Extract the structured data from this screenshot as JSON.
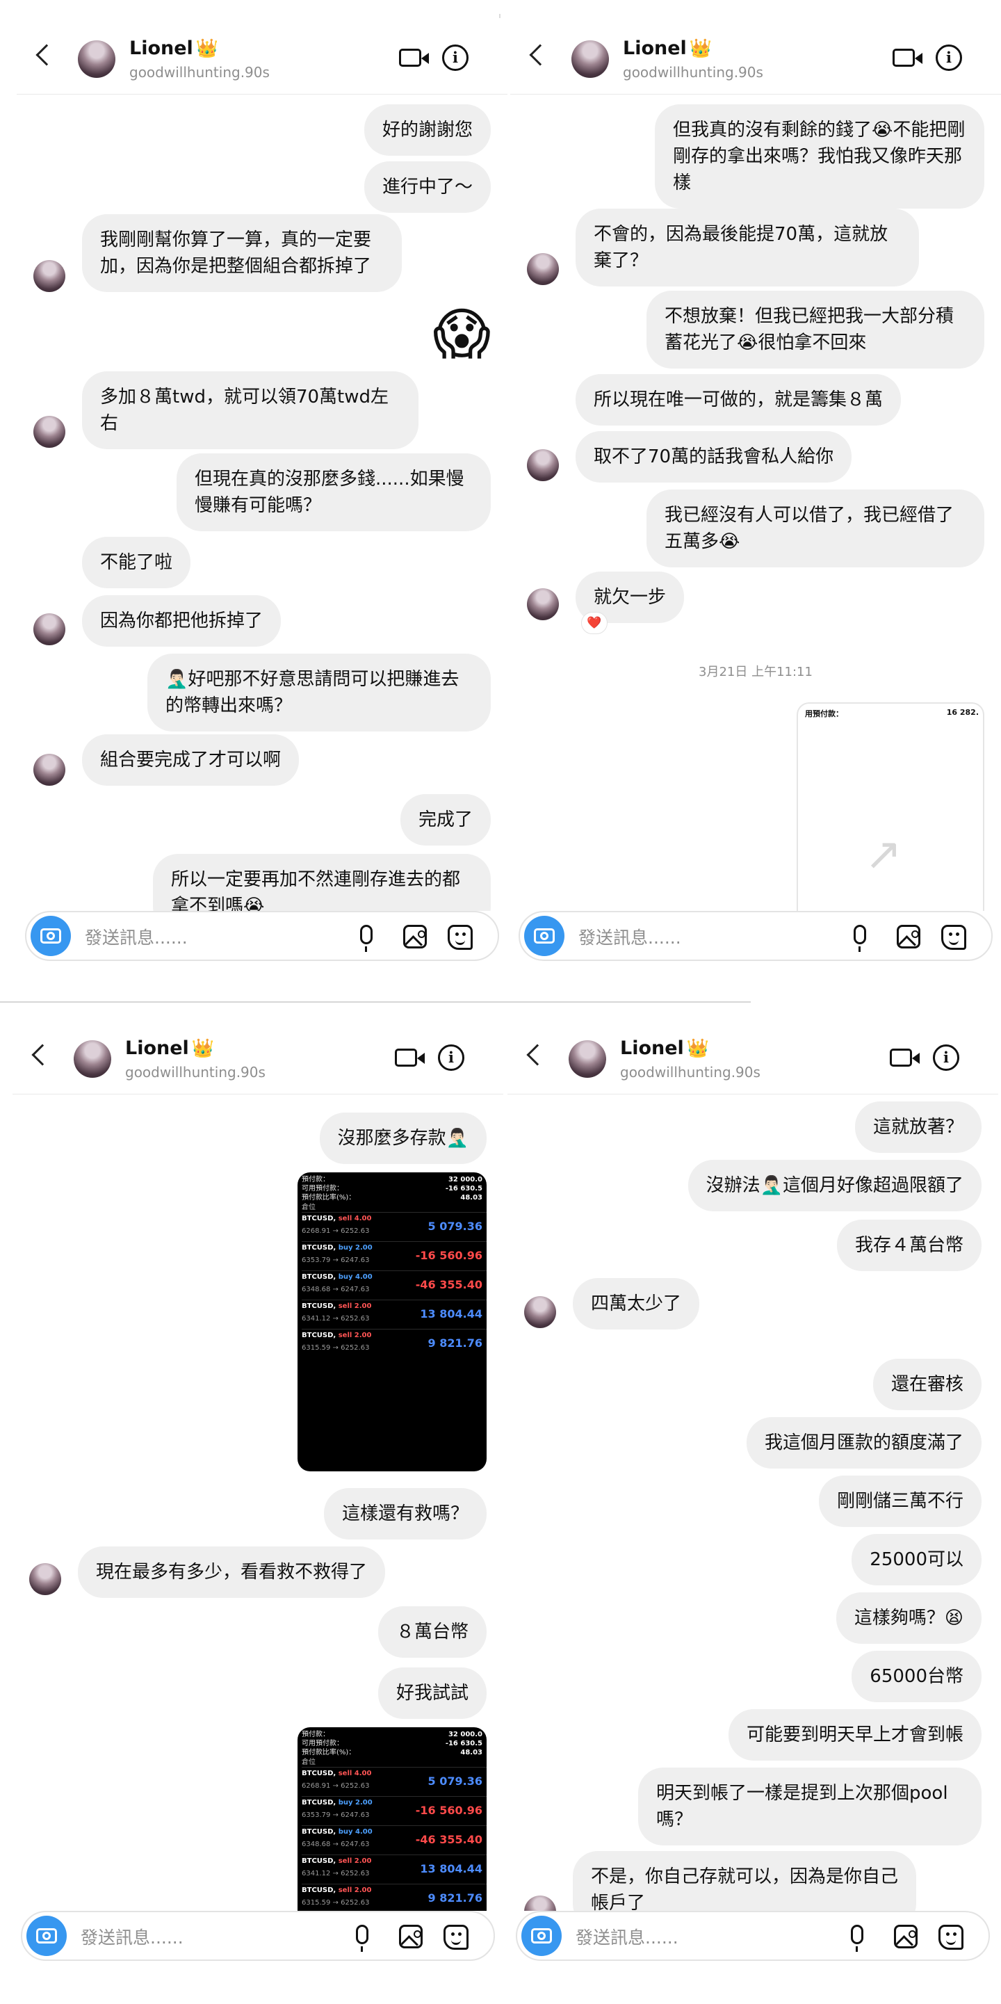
{
  "contact": {
    "name": "Lionel",
    "crown": "👑",
    "handle": "goodwillhunting.90s"
  },
  "composer": {
    "placeholder": "發送訊息......"
  },
  "panel1": {
    "messages": {
      "m1": "好的謝謝您",
      "m2": "進行中了～",
      "m3": "我剛剛幫你算了一算，真的一定要加，因為你是把整個組合都拆掉了",
      "m4": "😱",
      "m5": "多加８萬twd，就可以領70萬twd左右",
      "m6": "但現在真的沒那麼多錢......如果慢慢賺有可能嗎？",
      "m7": "不能了啦",
      "m8": "因為你都把他拆掉了",
      "m9": "🤦🏻‍♂️好吧那不好意思請問可以把賺進去的幣轉出來嗎？",
      "m10": "組合要完成了才可以啊",
      "m11": "完成了",
      "m12": "所以一定要再加不然連剛存進去的都拿不到嗎😭"
    }
  },
  "panel2": {
    "messages": {
      "m1": "但我真的沒有剩餘的錢了😭不能把剛剛存的拿出來嗎？我怕我又像昨天那樣",
      "m2": "不會的，因為最後能提70萬，這就放棄了？",
      "m3": "不想放棄！但我已經把我一大部分積蓄花光了😭很怕拿不回來",
      "m4": "所以現在唯一可做的，就是籌集８萬",
      "m5": "取不了70萬的話我會私人給你",
      "m6": "我已經沒有人可以借了，我已經借了五萬多😭",
      "m7": "就欠一步",
      "reaction": "❤️"
    },
    "timestamp": "3月21日 上午11:11",
    "shot": {
      "left_text": "用預付款：",
      "right_text": "16 282.",
      "icon": "↗"
    }
  },
  "panel3": {
    "messages": {
      "m1": "沒那麼多存款🤦🏻‍♂️",
      "m2": "這樣還有救嗎？",
      "m3": "現在最多有多少，看看救不救得了",
      "m4": "８萬台幣",
      "m5": "好我試試"
    },
    "trading": {
      "acc1_label": "預付款：",
      "acc1_value": "32 000.0",
      "acc2_label": "可用預付款：",
      "acc2_value": "-16 630.5",
      "acc3_label": "預付款比率(%)：",
      "acc3_value": "48.03",
      "positions_label": "倉位",
      "rows": [
        {
          "sym": "BTCUSD,",
          "side": "sell 4.00",
          "prices": "6268.91 → 6252.63",
          "value": "5 079.36"
        },
        {
          "sym": "BTCUSD,",
          "side": "buy 2.00",
          "prices": "6353.79 → 6247.63",
          "value": "-16 560.96"
        },
        {
          "sym": "BTCUSD,",
          "side": "buy 4.00",
          "prices": "6348.68 → 6247.63",
          "value": "-46 355.40"
        },
        {
          "sym": "BTCUSD,",
          "side": "sell 2.00",
          "prices": "6341.12 → 6252.63",
          "value": "13 804.44"
        },
        {
          "sym": "BTCUSD,",
          "side": "sell 2.00",
          "prices": "6315.59 → 6252.63",
          "value": "9 821.76"
        }
      ]
    }
  },
  "panel4": {
    "messages": {
      "m1": "這就放著？",
      "m2": "沒辦法🤦🏻‍♂️這個月好像超過限額了",
      "m3": "我存４萬台幣",
      "m4": "四萬太少了",
      "m5": "還在審核",
      "m6": "我這個月匯款的額度滿了",
      "m7": "剛剛儲三萬不行",
      "m8": "25000可以",
      "m9": "這樣夠嗎？😫",
      "m10": "65000台幣",
      "m11": "可能要到明天早上才會到帳",
      "m12": "明天到帳了一樣是提到上次那個pool嗎？",
      "m13": "不是，你自己存就可以，因為是你自己帳戶了"
    }
  },
  "colors": {
    "bubble": "#efefef",
    "accent": "#3797f0",
    "muted": "#8e8e8e",
    "negative": "#ff4a4a",
    "positive": "#4d8cff"
  }
}
